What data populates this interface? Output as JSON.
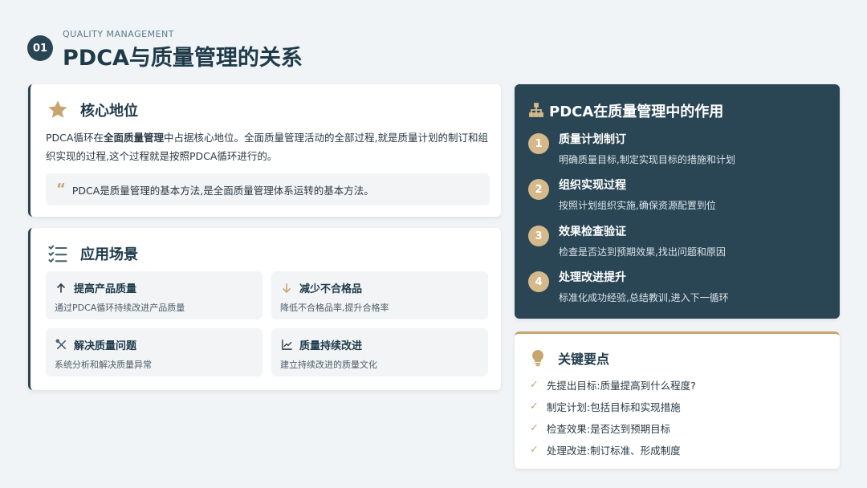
{
  "header": {
    "number": "01",
    "subtitle": "QUALITY MANAGEMENT",
    "title": "PDCA与质量管理的关系"
  },
  "core": {
    "title": "核心地位",
    "icon": "star-icon",
    "para_1": "PDCA循环在",
    "para_bold": "全面质量管理",
    "para_2": "中占据核心地位。全面质量管理活动的全部过程,就是质量计划的制订和组织实现的过程,这个过程就是按照PDCA循环进行的。",
    "quote": "PDCA是质量管理的基本方法,是全面质量管理体系运转的基本方法。"
  },
  "apps": {
    "title": "应用场景",
    "icon": "checklist-icon",
    "items": [
      {
        "title": "提高产品质量",
        "desc": "通过PDCA循环持续改进产品质量",
        "icon": "arrow-up-icon"
      },
      {
        "title": "减少不合格品",
        "desc": "降低不合格品率,提升合格率",
        "icon": "arrow-down-icon"
      },
      {
        "title": "解决质量问题",
        "desc": "系统分析和解决质量异常",
        "icon": "tools-icon"
      },
      {
        "title": "质量持续改进",
        "desc": "建立持续改进的质量文化",
        "icon": "chart-line-icon"
      }
    ]
  },
  "role": {
    "title": "PDCA在质量管理中的作用",
    "icon": "hierarchy-icon",
    "steps": [
      {
        "num": "1",
        "title": "质量计划制订",
        "desc": "明确质量目标,制定实现目标的措施和计划"
      },
      {
        "num": "2",
        "title": "组织实现过程",
        "desc": "按照计划组织实施,确保资源配置到位"
      },
      {
        "num": "3",
        "title": "效果检查验证",
        "desc": "检查是否达到预期效果,找出问题和原因"
      },
      {
        "num": "4",
        "title": "处理改进提升",
        "desc": "标准化成功经验,总结教训,进入下一循环"
      }
    ]
  },
  "keys": {
    "title": "关键要点",
    "icon": "lightbulb-icon",
    "items": [
      "先提出目标:质量提高到什么程度?",
      "制定计划:包括目标和实现措施",
      "检查效果:是否达到预期目标",
      "处理改进:制订标准、形成制度"
    ]
  },
  "colors": {
    "navy": "#2a4654",
    "gold": "#c8a46e",
    "background": "#f1f4f6"
  }
}
